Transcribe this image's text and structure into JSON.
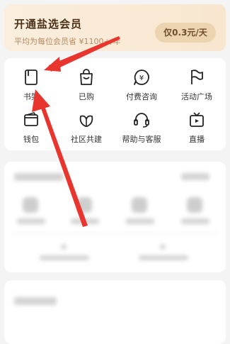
{
  "banner": {
    "title": "开通盐选会员",
    "subtitle": "平均为每位会员省 ¥1100+/年",
    "button": "仅0.3元/天"
  },
  "services": [
    {
      "label": "书架",
      "icon": "bookshelf-icon"
    },
    {
      "label": "已购",
      "icon": "shopping-bag-icon"
    },
    {
      "label": "付费咨询",
      "icon": "yen-chat-icon"
    },
    {
      "label": "活动广场",
      "icon": "flag-icon"
    },
    {
      "label": "钱包",
      "icon": "wallet-icon"
    },
    {
      "label": "社区共建",
      "icon": "leaf-icon"
    },
    {
      "label": "帮助与客服",
      "icon": "headset-icon"
    },
    {
      "label": "直播",
      "icon": "tv-icon"
    }
  ],
  "annotations": {
    "arrow_color": "#e8352e"
  }
}
